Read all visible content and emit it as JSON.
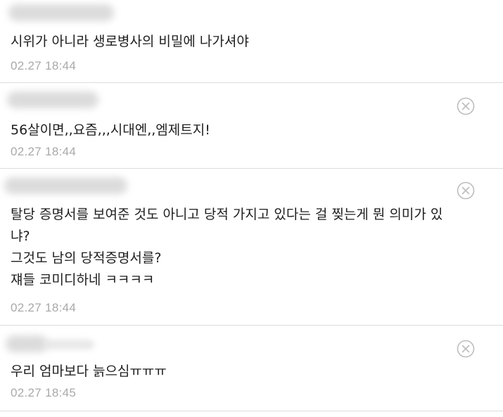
{
  "comments": [
    {
      "lines": [
        "시위가 아니라 생로병사의 비밀에 나가셔야"
      ],
      "time": "02.27 18:44"
    },
    {
      "lines": [
        "56살이면,,요즘,,,시대엔,,엠제트지!"
      ],
      "time": "02.27 18:44"
    },
    {
      "lines": [
        "탈당 증명서를 보여준 것도 아니고 당적 가지고 있다는 걸 찢는게 뭔 의미가 있",
        "냐?",
        "그것도 남의 당적증명서를?",
        "쟤들 코미디하네 ㅋㅋㅋㅋ"
      ],
      "time": "02.27 18:44"
    },
    {
      "lines": [
        "우리 엄마보다 늙으심ㅠㅠㅠ"
      ],
      "time": "02.27 18:45"
    }
  ],
  "icons": {
    "delete": "close-circle-icon"
  },
  "colors": {
    "text": "#1e1e1e",
    "timestamp": "#a9a9a9",
    "divider": "#dcdcdc",
    "icon": "#bdbdbd"
  }
}
